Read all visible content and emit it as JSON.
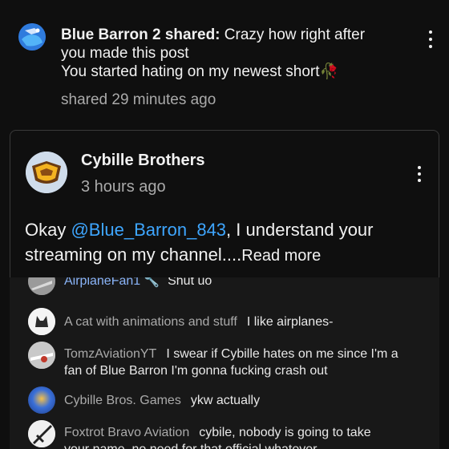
{
  "share": {
    "author": "Blue Barron 2 shared:",
    "message_line1": "Crazy how right after",
    "message_line2": "you made this post",
    "message_line3": "You started hating on my newest short",
    "message_emoji": "🥀",
    "message_tail": "🥀",
    "time": "shared 29 minutes ago",
    "avatar_icon": "avatar-blue-barron"
  },
  "card": {
    "author": "Cybille Brothers",
    "time": "3 hours ago",
    "body_prefix": "Okay ",
    "mention": "@Blue_Barron_843",
    "body_line1_rest": ", I understand your",
    "body_line2": "streaming on my channel.",
    "ellipsis": "...",
    "read_more": "Read more"
  },
  "comments": [
    {
      "name": "AirplaneFan1",
      "badge": "🔧",
      "text": "Shut uo"
    },
    {
      "name": "A cat with animations and stuff",
      "text": "I like airplanes-"
    },
    {
      "name": "TomzAviationYT",
      "text": "I swear if Cybille hates on me since I'm a",
      "text2": "fan of Blue Barron I'm gonna fucking crash out"
    },
    {
      "name": "Cybille Bros. Games",
      "text": "ykw actually"
    },
    {
      "name": "Foxtrot Bravo Aviation",
      "text": "cybile, nobody is going to take",
      "text2": "your name, no need for that official whatever"
    }
  ],
  "colors": {
    "background": "#0f0f0f",
    "secondary_text": "#aaaaaa",
    "link": "#3ea6ff",
    "verified_name": "#8ab4f8"
  }
}
